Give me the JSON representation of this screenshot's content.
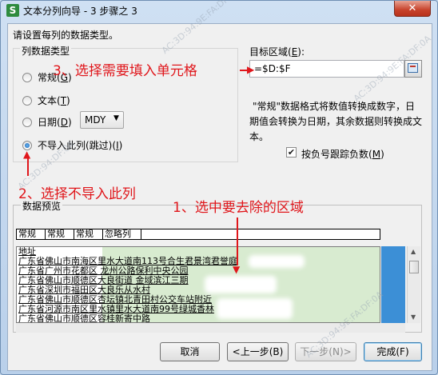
{
  "window": {
    "title": "文本分列向导 - 3 步骤之 3",
    "app_icon_letter": "S",
    "close_glyph": "✕"
  },
  "instruction": "请设置每列的数据类型。",
  "column_type": {
    "legend": "列数据类型",
    "options": [
      {
        "label": "常规",
        "key": "G",
        "checked": false
      },
      {
        "label": "文本",
        "key": "T",
        "checked": false
      },
      {
        "label": "日期",
        "key": "D",
        "checked": false
      },
      {
        "label": "不导入此列(跳过)",
        "key": "I",
        "checked": true
      }
    ],
    "date_format": "MDY"
  },
  "target": {
    "label": "目标区域",
    "key": "E",
    "value": "=$D:$F"
  },
  "description": [
    "\"常规\"数据格式将数值转换成数字，日",
    "期值会转换为日期，其余数据则转换成文",
    "本。"
  ],
  "trailing_minus": {
    "label": "按负号跟踪负数",
    "key": "M",
    "checked": true
  },
  "preview": {
    "label": "数据预览",
    "column_headers": [
      "常规",
      "常规",
      "常规",
      "忽略列"
    ],
    "rows": [
      "地址",
      "广东省佛山市南海区里水大道南113号合生君景湾君誉庭",
      "广东省广州市花都区 龙州公路保利中央公园",
      "广东省佛山市顺德区大良街道 金域滨江三期",
      "广东省深圳市福田区大良乐从水村",
      "广东省佛山市顺德区杏坛镇北青田村公交车站附近",
      "广东省河源市南区里水镇里水大道南99号绿城香林",
      "广东省佛山市顺德区容桂新寄中路"
    ]
  },
  "buttons": {
    "cancel": "取消",
    "back": "<上一步(B)",
    "next": "下一步(N)>",
    "finish": "完成(F)"
  },
  "annotations": {
    "step3": "3、选择需要填入单元格",
    "step2": "2、选择不导入此列",
    "step1": "1、选中要去除的区域"
  },
  "colors": {
    "annotation": "#e0161b",
    "title_bar": "#c3d7ee",
    "shaded_columns": "#d8ebd0",
    "selection_blue": "#3c8fd6"
  }
}
